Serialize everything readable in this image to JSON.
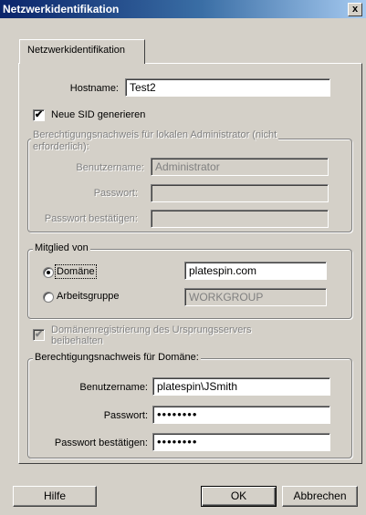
{
  "window": {
    "title": "Netzwerkidentifikation",
    "close": "x"
  },
  "tab": {
    "label": "Netzwerkidentifikation"
  },
  "hostname": {
    "label": "Hostname:",
    "value": "Test2"
  },
  "new_sid": {
    "label": "Neue SID generieren",
    "checked": true
  },
  "local_admin": {
    "legend": "Berechtigungsnachweis für lokalen Administrator (nicht erforderlich):",
    "legend_line1": "Berechtigungsnachweis für lokalen Administrator (nicht",
    "legend_line2": "erforderlich):",
    "user_label": "Benutzername:",
    "user_value": "Administrator",
    "pw_label": "Passwort:",
    "pw_value": "",
    "pw_confirm_label": "Passwort bestätigen:",
    "pw_confirm_value": ""
  },
  "member_of": {
    "legend": "Mitglied von",
    "domain_label": "Domäne",
    "domain_value": "platespin.com",
    "domain_selected": true,
    "workgroup_label": "Arbeitsgruppe",
    "workgroup_value": "WORKGROUP"
  },
  "keep_domain": {
    "label_line1": "Domänenregistrierung des Ursprungsservers",
    "label_line2": "beibehalten",
    "checked": true
  },
  "domain_cred": {
    "legend": "Berechtigungsnachweis für Domäne:",
    "user_label": "Benutzername:",
    "user_value": "platespin\\JSmith",
    "pw_label": "Passwort:",
    "pw_value": "••••••••",
    "pw_confirm_label": "Passwort bestätigen:",
    "pw_confirm_value": "••••••••"
  },
  "buttons": {
    "help": "Hilfe",
    "ok": "OK",
    "cancel": "Abbrechen"
  }
}
